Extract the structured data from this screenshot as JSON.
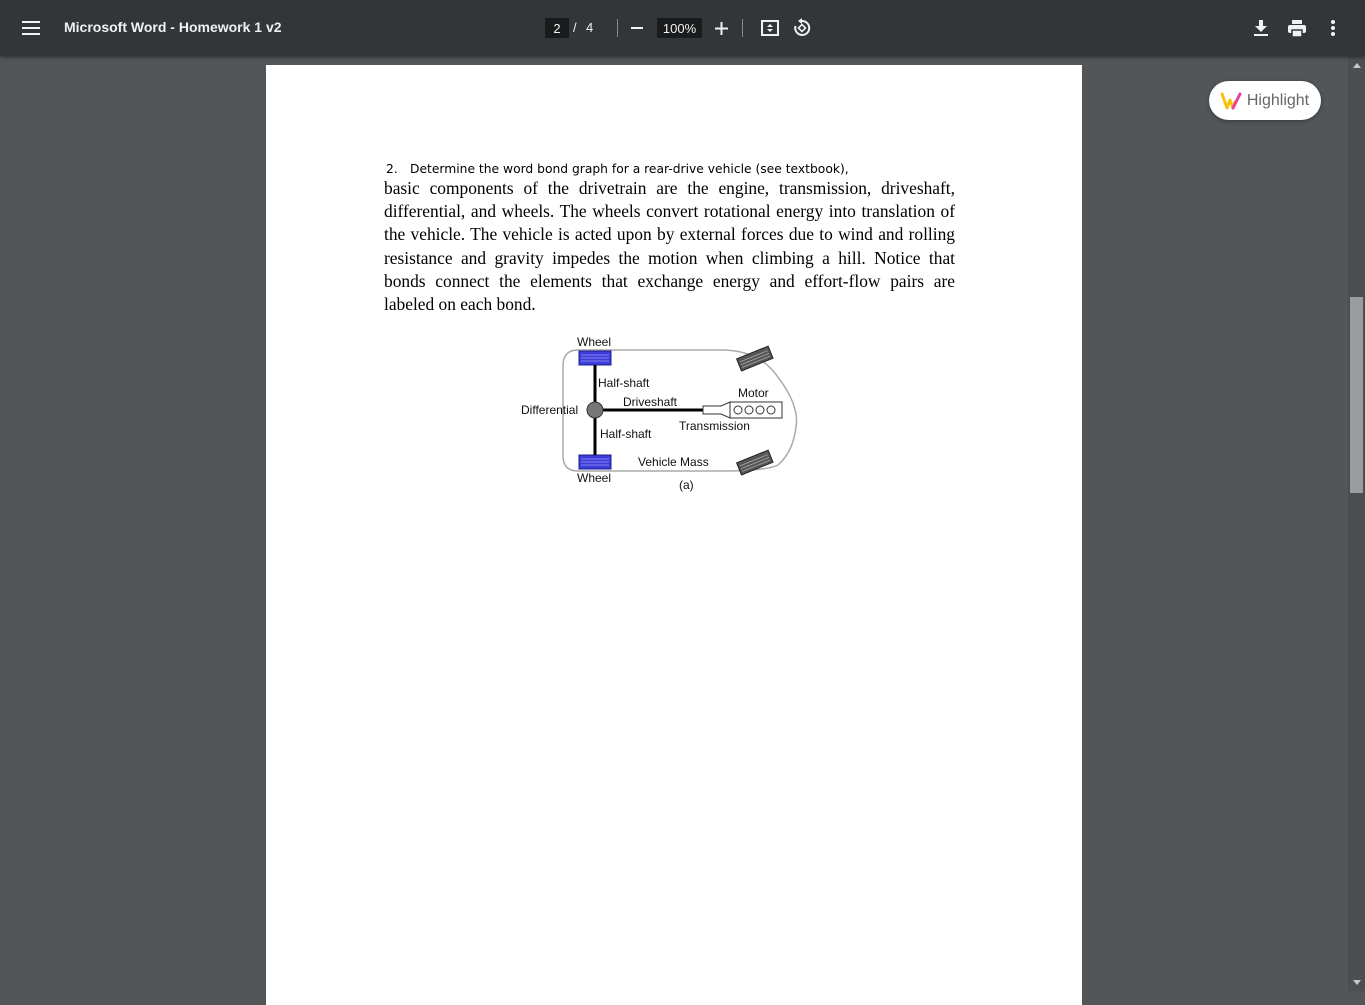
{
  "toolbar": {
    "title": "Microsoft Word - Homework 1 v2",
    "current_page": "2",
    "page_separator": "/",
    "total_pages": "4",
    "zoom": "100%",
    "icons": [
      "menu-icon",
      "minus-icon",
      "plus-icon",
      "fit-page-icon",
      "rotate-icon",
      "download-icon",
      "print-icon",
      "more-vert-icon"
    ]
  },
  "highlight": {
    "label": "Highlight",
    "logo_colors": [
      "#f7c10d",
      "#e83fa0"
    ]
  },
  "document": {
    "question_number": "2.",
    "question_text": "Determine the word bond graph for a rear-drive vehicle  (see textbook),",
    "paragraph": "basic components of the drivetrain are the engine, transmission, driveshaft, differential, and wheels. The wheels convert rotational energy into translation of the vehicle.  The vehicle is acted upon by external forces due to wind and rolling resistance and gravity impedes the motion when climbing a hill. Notice that bonds connect the elements that exchange energy and effort-flow pairs are labeled on each bond."
  },
  "figure": {
    "labels": {
      "wheel_top": "Wheel",
      "half_shaft_top": "Half-shaft",
      "driveshaft": "Driveshaft",
      "motor": "Motor",
      "differential": "Differential",
      "transmission": "Transmission",
      "half_shaft_bottom": "Half-shaft",
      "vehicle_mass": "Vehicle Mass",
      "wheel_bottom": "Wheel",
      "caption": "(a)"
    },
    "colors": {
      "rear_wheel": "#3d3ddb",
      "front_wheel": "#555555",
      "body_outline": "#aaaaaa"
    }
  },
  "colors": {
    "toolbar_bg": "#323639",
    "viewer_bg": "#525659",
    "page_bg": "#ffffff"
  }
}
